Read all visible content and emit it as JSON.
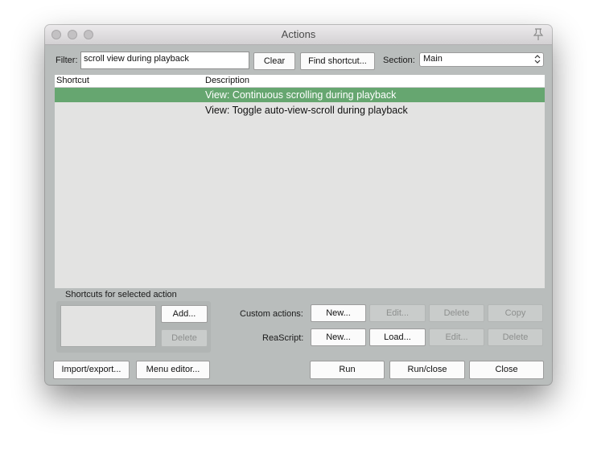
{
  "window": {
    "title": "Actions"
  },
  "filter": {
    "label": "Filter:",
    "value": "scroll view during playback"
  },
  "buttons": {
    "clear": "Clear",
    "find_shortcut": "Find shortcut...",
    "add": "Add...",
    "delete_shortcut": "Delete",
    "import_export": "Import/export...",
    "menu_editor": "Menu editor...",
    "run": "Run",
    "run_close": "Run/close",
    "close": "Close"
  },
  "section": {
    "label": "Section:",
    "selected": "Main"
  },
  "table": {
    "columns": [
      "Shortcut",
      "Description"
    ],
    "rows": [
      {
        "shortcut": "",
        "description": "View: Continuous scrolling during playback",
        "selected": true
      },
      {
        "shortcut": "",
        "description": "View: Toggle auto-view-scroll during playback",
        "selected": false
      }
    ]
  },
  "shortcuts_panel": {
    "label": "Shortcuts for selected action"
  },
  "custom_actions": {
    "label": "Custom actions:",
    "new": "New...",
    "edit": "Edit...",
    "delete": "Delete",
    "copy": "Copy"
  },
  "reascript": {
    "label": "ReaScript:",
    "new": "New...",
    "load": "Load...",
    "edit": "Edit...",
    "delete": "Delete"
  },
  "colors": {
    "selection": "#66a670",
    "window_bg": "#b9bdbc",
    "list_bg": "#e3e3e2"
  },
  "icons": [
    "close-light-icon",
    "minimize-light-icon",
    "zoom-light-icon",
    "pin-icon",
    "chevron-updown-icon"
  ]
}
